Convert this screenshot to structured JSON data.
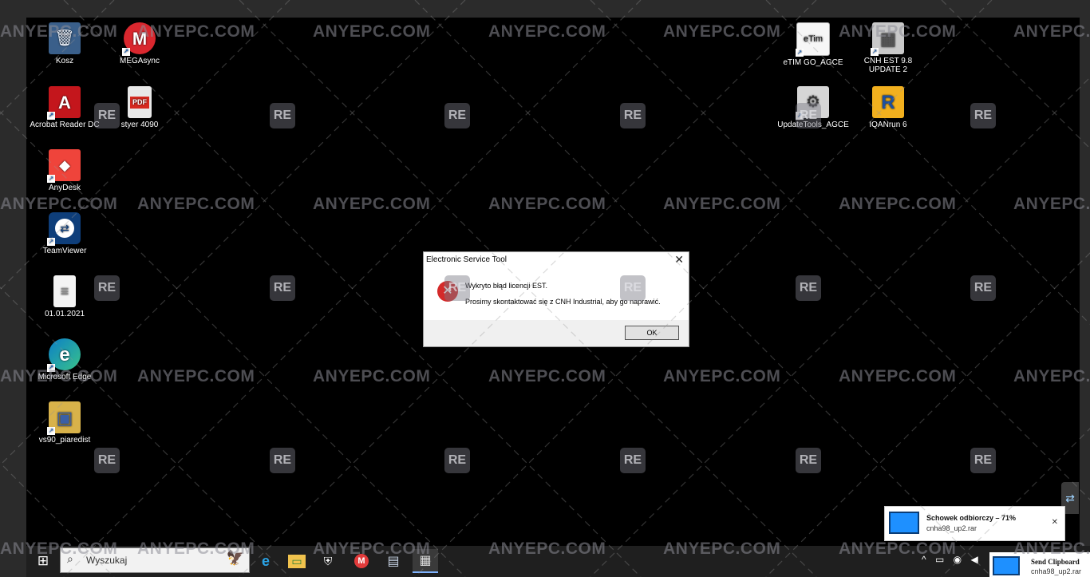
{
  "desktop": {
    "icons": [
      {
        "label": "Kosz",
        "icon": "recycle-bin-icon",
        "glyph": "🗑",
        "bg": "#3a5f8a"
      },
      {
        "label": "MEGAsync",
        "icon": "megasync-icon",
        "glyph": "M",
        "bg": "#d9272e"
      },
      {
        "label": "Acrobat Reader DC",
        "icon": "acrobat-icon",
        "glyph": "A",
        "bg": "#c4161c"
      },
      {
        "label": "styer 4090",
        "icon": "pdf-file-icon",
        "glyph": "PDF",
        "bg": "#e8e8e8"
      },
      {
        "label": "AnyDesk",
        "icon": "anydesk-icon",
        "glyph": "◆",
        "bg": "#ef443b"
      },
      {
        "label": "TeamViewer",
        "icon": "teamviewer-icon",
        "glyph": "⇄",
        "bg": "#0e3e7a"
      },
      {
        "label": "01.01.2021",
        "icon": "text-file-icon",
        "glyph": "≡",
        "bg": "#f4f4f4"
      },
      {
        "label": "Microsoft Edge",
        "icon": "edge-icon",
        "glyph": "e",
        "bg": "#0c7fc7"
      },
      {
        "label": "vs90_piaredist",
        "icon": "installer-icon",
        "glyph": "▣",
        "bg": "#d8b24a"
      },
      {
        "label": "eTIM GO_AGCE",
        "icon": "etim-icon",
        "glyph": "eTim",
        "bg": "#f6f6f6"
      },
      {
        "label": "CNH EST 9.8 UPDATE 2",
        "icon": "cnh-est-icon",
        "glyph": "▦",
        "bg": "#c9c9c9"
      },
      {
        "label": "UpdateTools_AGCE",
        "icon": "update-tools-icon",
        "glyph": "⚙",
        "bg": "#d6d6d6"
      },
      {
        "label": "IQANrun 6",
        "icon": "iqanrun-icon",
        "glyph": "R",
        "bg": "#f2b01e"
      }
    ]
  },
  "dialog": {
    "title": "Electronic Service Tool",
    "close": "✕",
    "message1": "Wykryto błąd licencji EST.",
    "message2": "Prosimy skontaktować się z CNH Industrial, aby go naprawić.",
    "ok_label": "OK"
  },
  "watermark": {
    "text": "ANYEPC.COM",
    "badge": "RE"
  },
  "notification": {
    "title": "Schowek odbiorczy – 71%",
    "file": "cnha98_up2.rar",
    "close": "✕"
  },
  "notification2": {
    "title": "Send Clipboard",
    "file": "cnha98_up2.rar"
  },
  "taskbar": {
    "search_placeholder": "Wyszukaj",
    "start_glyph": "⊞",
    "search_glyph": "⌕",
    "apps": [
      {
        "icon": "edge-taskbar-icon",
        "glyph": "e",
        "color": "#2aa3e6"
      },
      {
        "icon": "file-explorer-icon",
        "glyph": "▭",
        "color": "#f0c24d"
      },
      {
        "icon": "security-icon",
        "glyph": "⛨",
        "color": "#ffffff"
      },
      {
        "icon": "megasync-taskbar-icon",
        "glyph": "M",
        "color": "#e23b3b"
      },
      {
        "icon": "network-app-icon",
        "glyph": "▤",
        "color": "#c8d4e6"
      },
      {
        "icon": "calendar-app-icon",
        "glyph": "▦",
        "color": "#dddddd"
      }
    ],
    "tray": {
      "chevron": "^",
      "battery": "▭",
      "network": "◉",
      "volume": "◀"
    }
  },
  "side_button": {
    "glyph": "⇄"
  }
}
